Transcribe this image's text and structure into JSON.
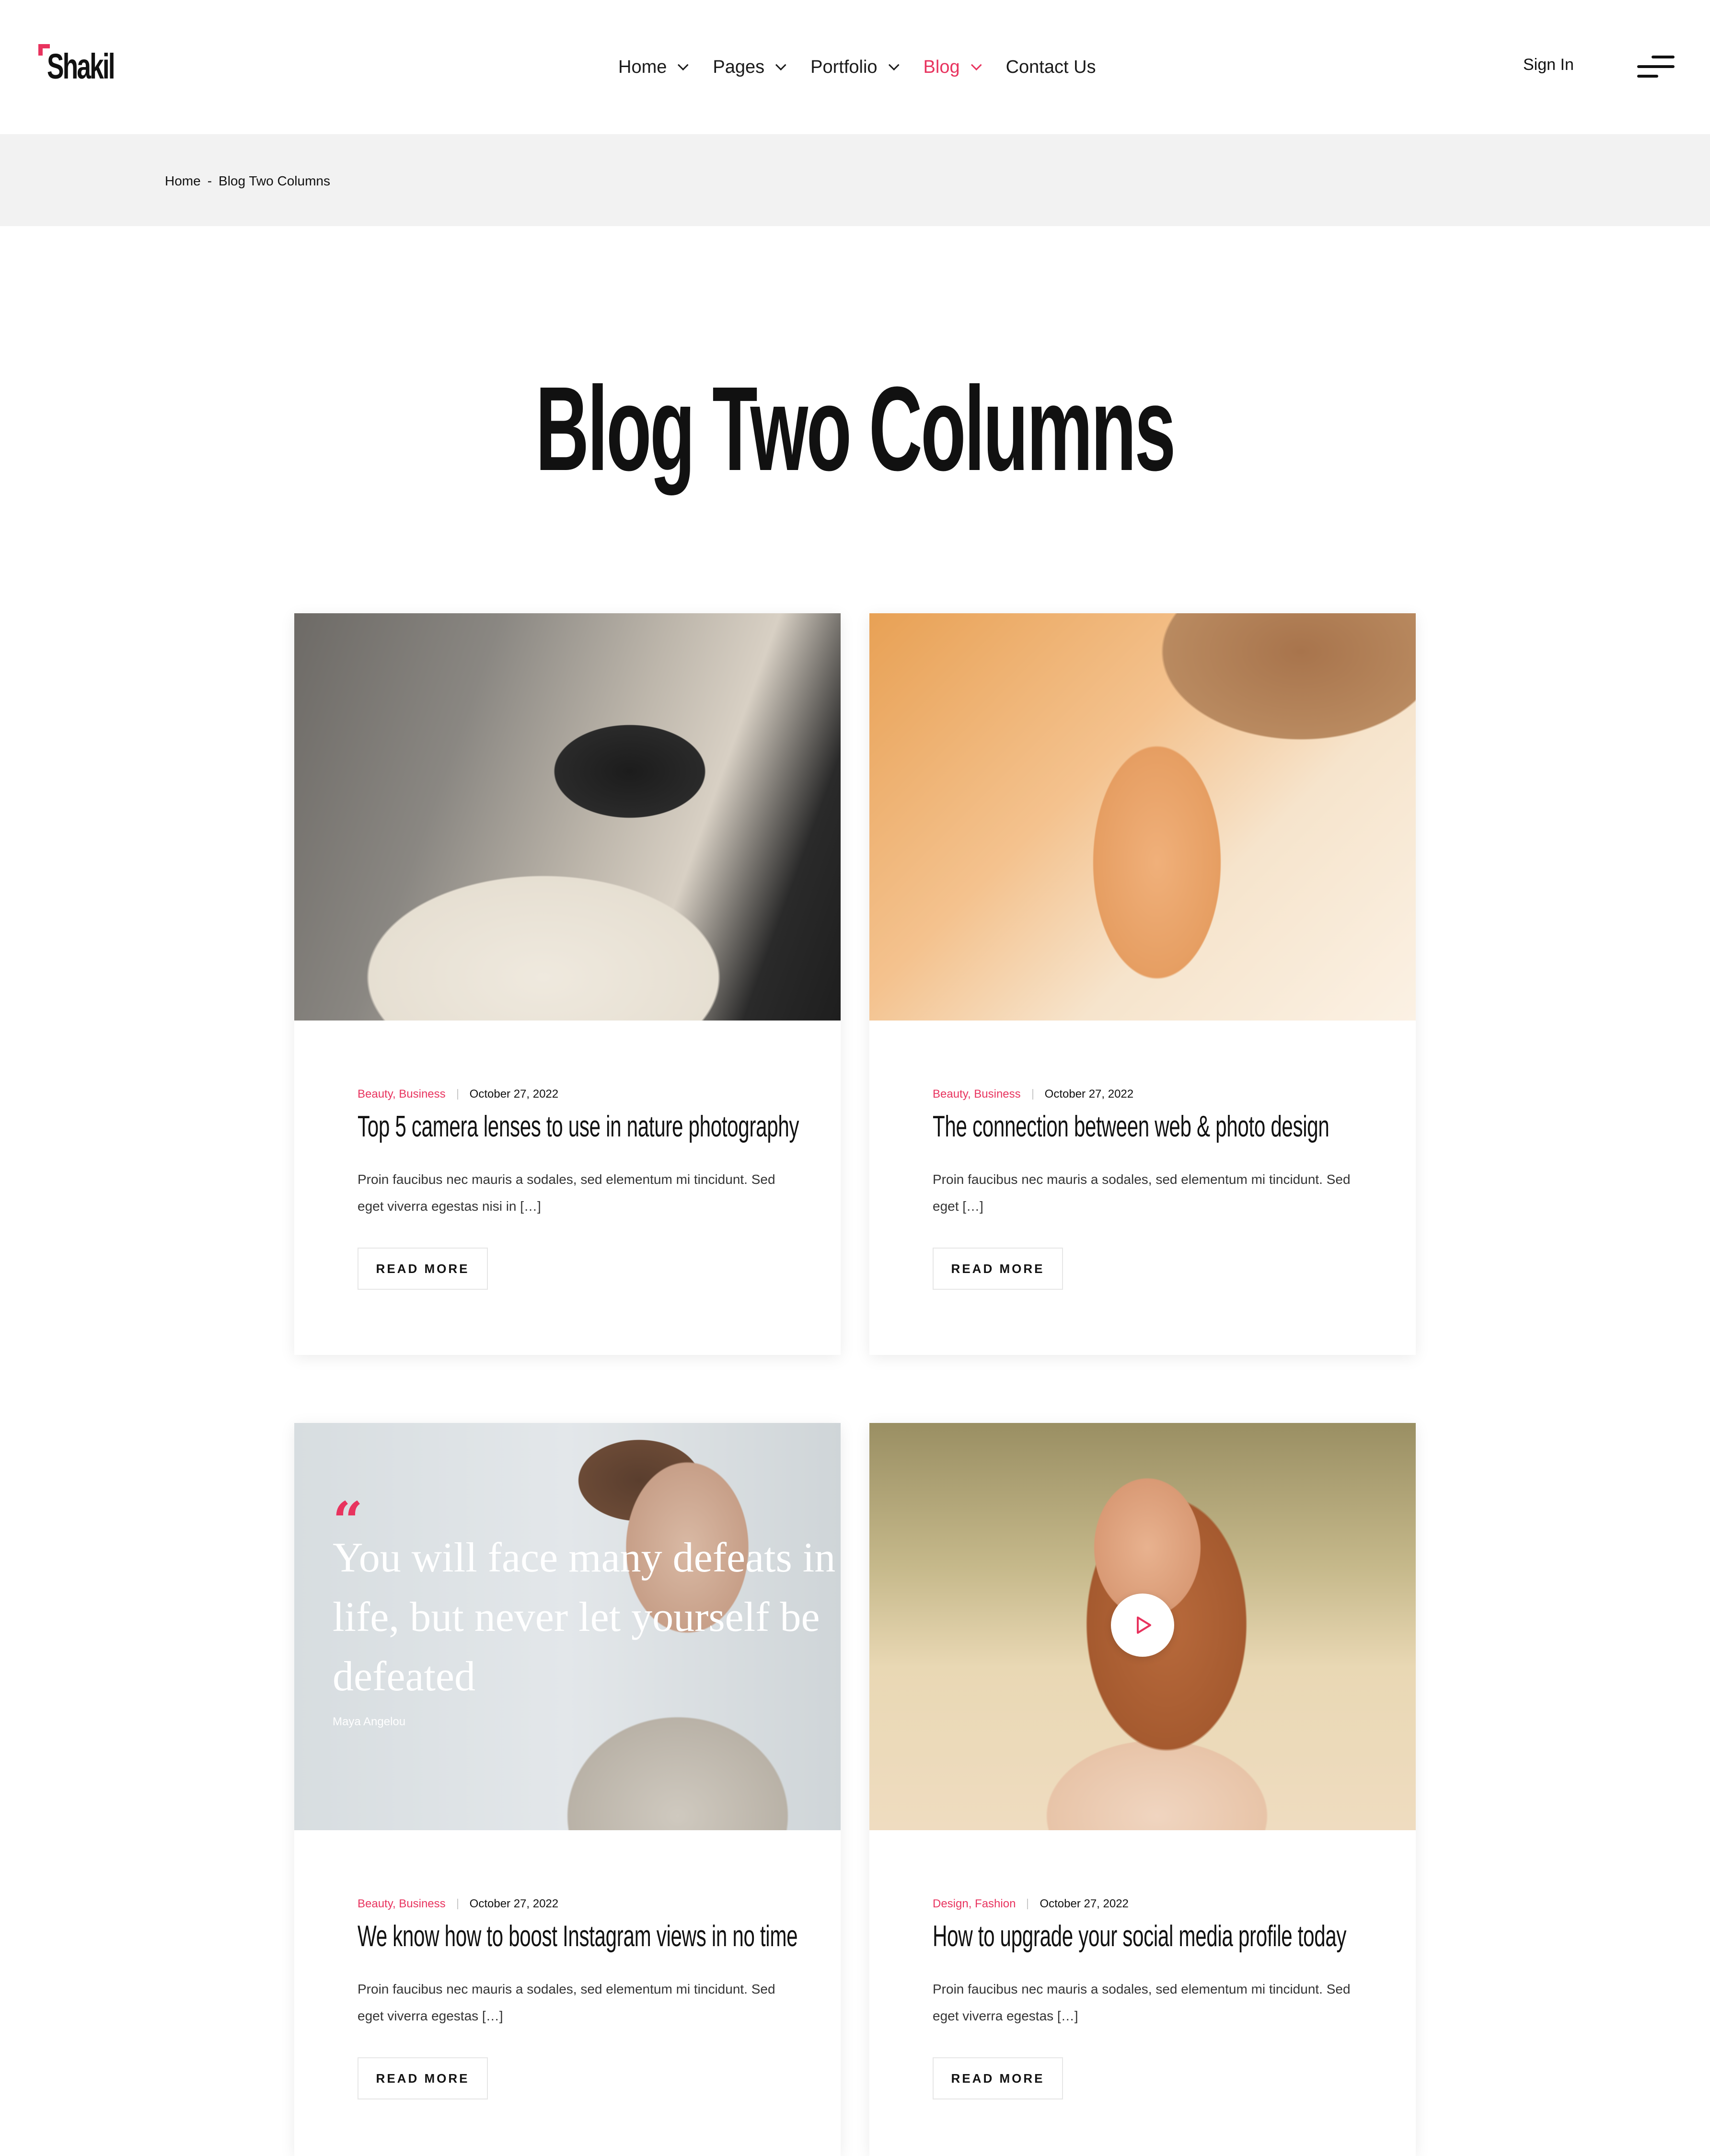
{
  "header": {
    "logo": "Shakil",
    "nav": [
      {
        "label": "Home",
        "active": false
      },
      {
        "label": "Pages",
        "active": false
      },
      {
        "label": "Portfolio",
        "active": false
      },
      {
        "label": "Blog",
        "active": true
      },
      {
        "label": "Contact Us",
        "active": false
      }
    ],
    "sign_in": "Sign In",
    "menu_icon": "hamburger-icon"
  },
  "breadcrumb": {
    "home": "Home",
    "separator": "-",
    "current": "Blog Two Columns"
  },
  "page_title": "Blog Two Columns",
  "posts": [
    {
      "categories": "Beauty, Business",
      "date": "October 27, 2022",
      "title": "Top 5 camera lenses to use in nature photography",
      "excerpt": "Proin faucibus nec mauris a sodales, sed elementum mi tincidunt. Sed eget viverra egestas nisi in […]",
      "read_more": "READ MORE"
    },
    {
      "categories": "Beauty, Business",
      "date": "October 27, 2022",
      "title": "The connection between web & photo design",
      "excerpt": "Proin faucibus nec mauris a sodales, sed elementum mi tincidunt. Sed eget […]",
      "read_more": "READ MORE"
    },
    {
      "quote": {
        "text": "You will face many defeats in life, but never let yourself be defeated",
        "author": "Maya Angelou"
      },
      "categories": "Beauty, Business",
      "date": "October 27, 2022",
      "title": "We know how to boost Instagram views in no time",
      "excerpt": "Proin faucibus nec mauris a sodales, sed elementum mi tincidunt. Sed eget viverra egestas […]",
      "read_more": "READ MORE"
    },
    {
      "categories": "Design, Fashion",
      "date": "October 27, 2022",
      "title": "How to upgrade your social media profile today",
      "excerpt": "Proin faucibus nec mauris a sodales, sed elementum mi tincidunt. Sed eget viverra egestas […]",
      "read_more": "READ MORE"
    }
  ],
  "colors": {
    "accent": "#e8335e",
    "text": "#111111",
    "breadcrumb_bg": "#f2f2f2"
  }
}
